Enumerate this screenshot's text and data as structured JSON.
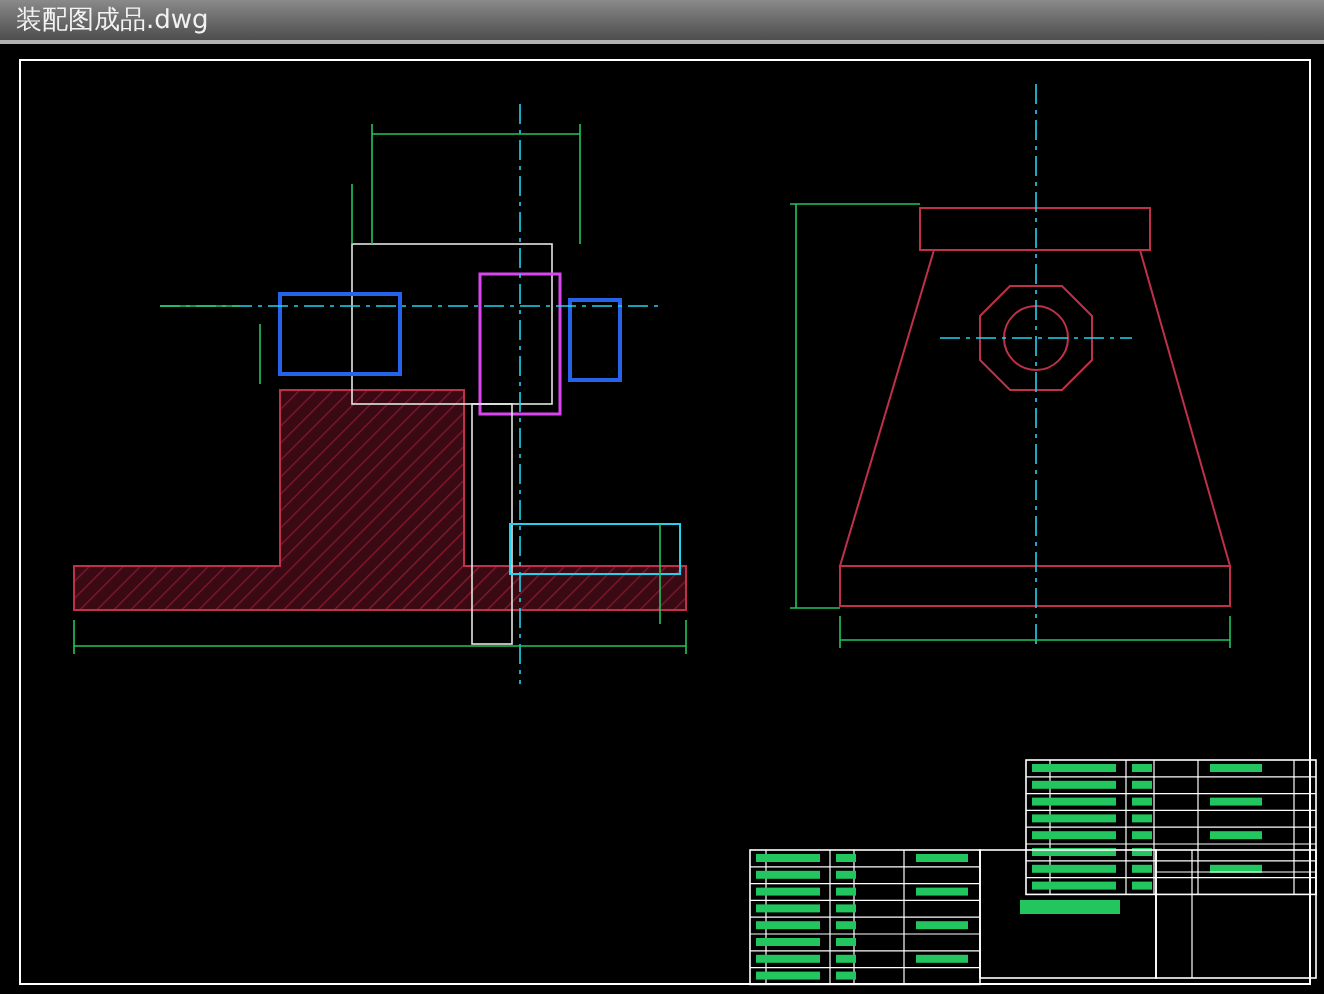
{
  "window": {
    "title": "装配图成品.dwg"
  }
}
